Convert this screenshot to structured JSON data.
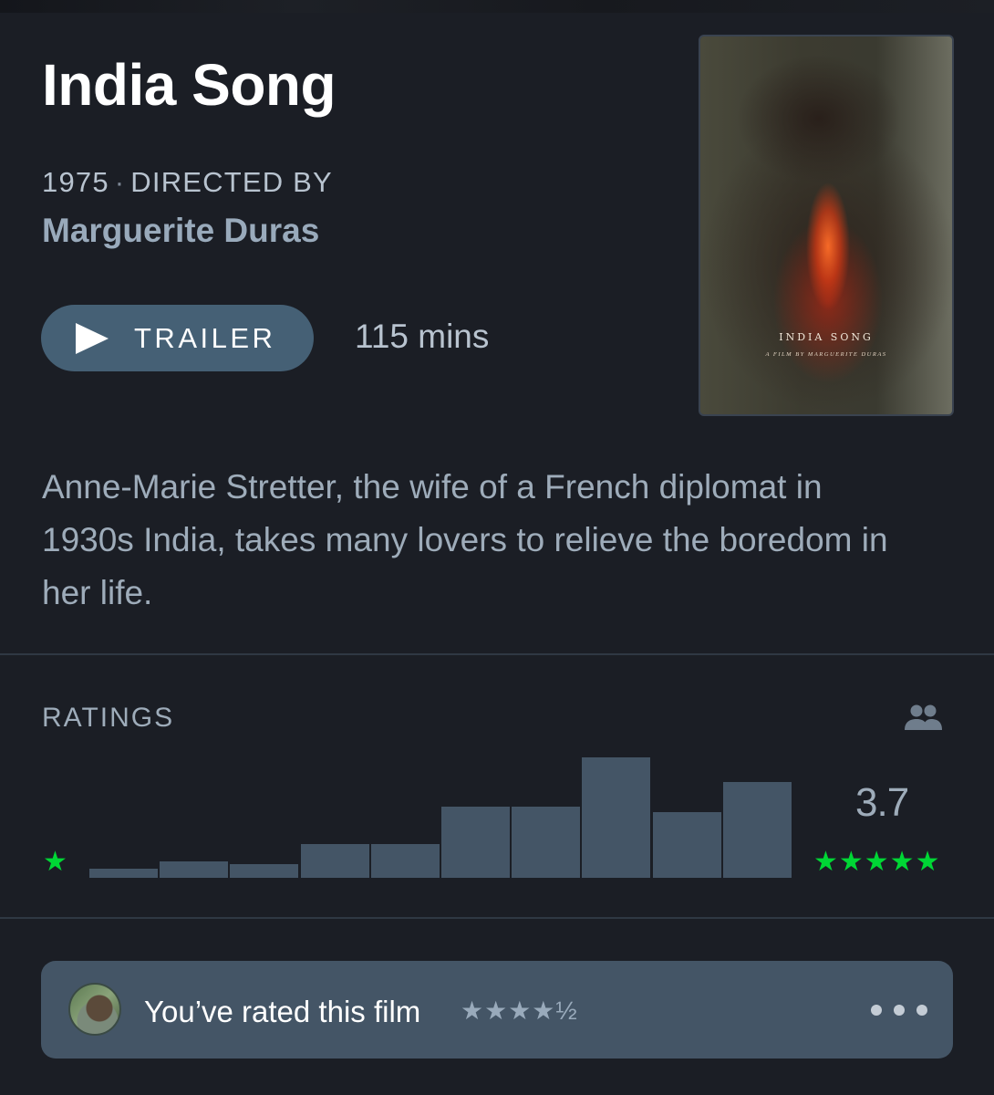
{
  "film": {
    "title": "India Song",
    "year": "1975",
    "directed_by_label": "DIRECTED BY",
    "director": "Marguerite Duras",
    "runtime": "115 mins",
    "synopsis": "Anne-Marie Stretter, the wife of a French diplomat in 1930s India, takes many lovers to relieve the boredom in her life."
  },
  "trailer": {
    "label": "TRAILER"
  },
  "poster": {
    "title": "INDIA SONG",
    "subtitle": "A FILM BY MARGUERITE DURAS"
  },
  "ratings": {
    "label": "RATINGS",
    "average": "3.7",
    "low_star": "★",
    "high_stars": "★★★★★",
    "accent_color": "#00d735",
    "bar_color": "#445566"
  },
  "chart_data": {
    "type": "bar",
    "categories": [
      "0.5",
      "1",
      "1.5",
      "2",
      "2.5",
      "3",
      "3.5",
      "4",
      "4.5",
      "5"
    ],
    "values": [
      7,
      13,
      11,
      27,
      27,
      57,
      57,
      97,
      53,
      77
    ],
    "title": "",
    "xlabel": "",
    "ylabel": "",
    "ylim": [
      0,
      100
    ],
    "grid": false
  },
  "user_rating": {
    "text": "You’ve rated this film",
    "stars": "★★★★½"
  },
  "icons": {
    "play": "play-icon",
    "people": "people-icon",
    "more": "more-horizontal-icon",
    "avatar": "avatar"
  }
}
